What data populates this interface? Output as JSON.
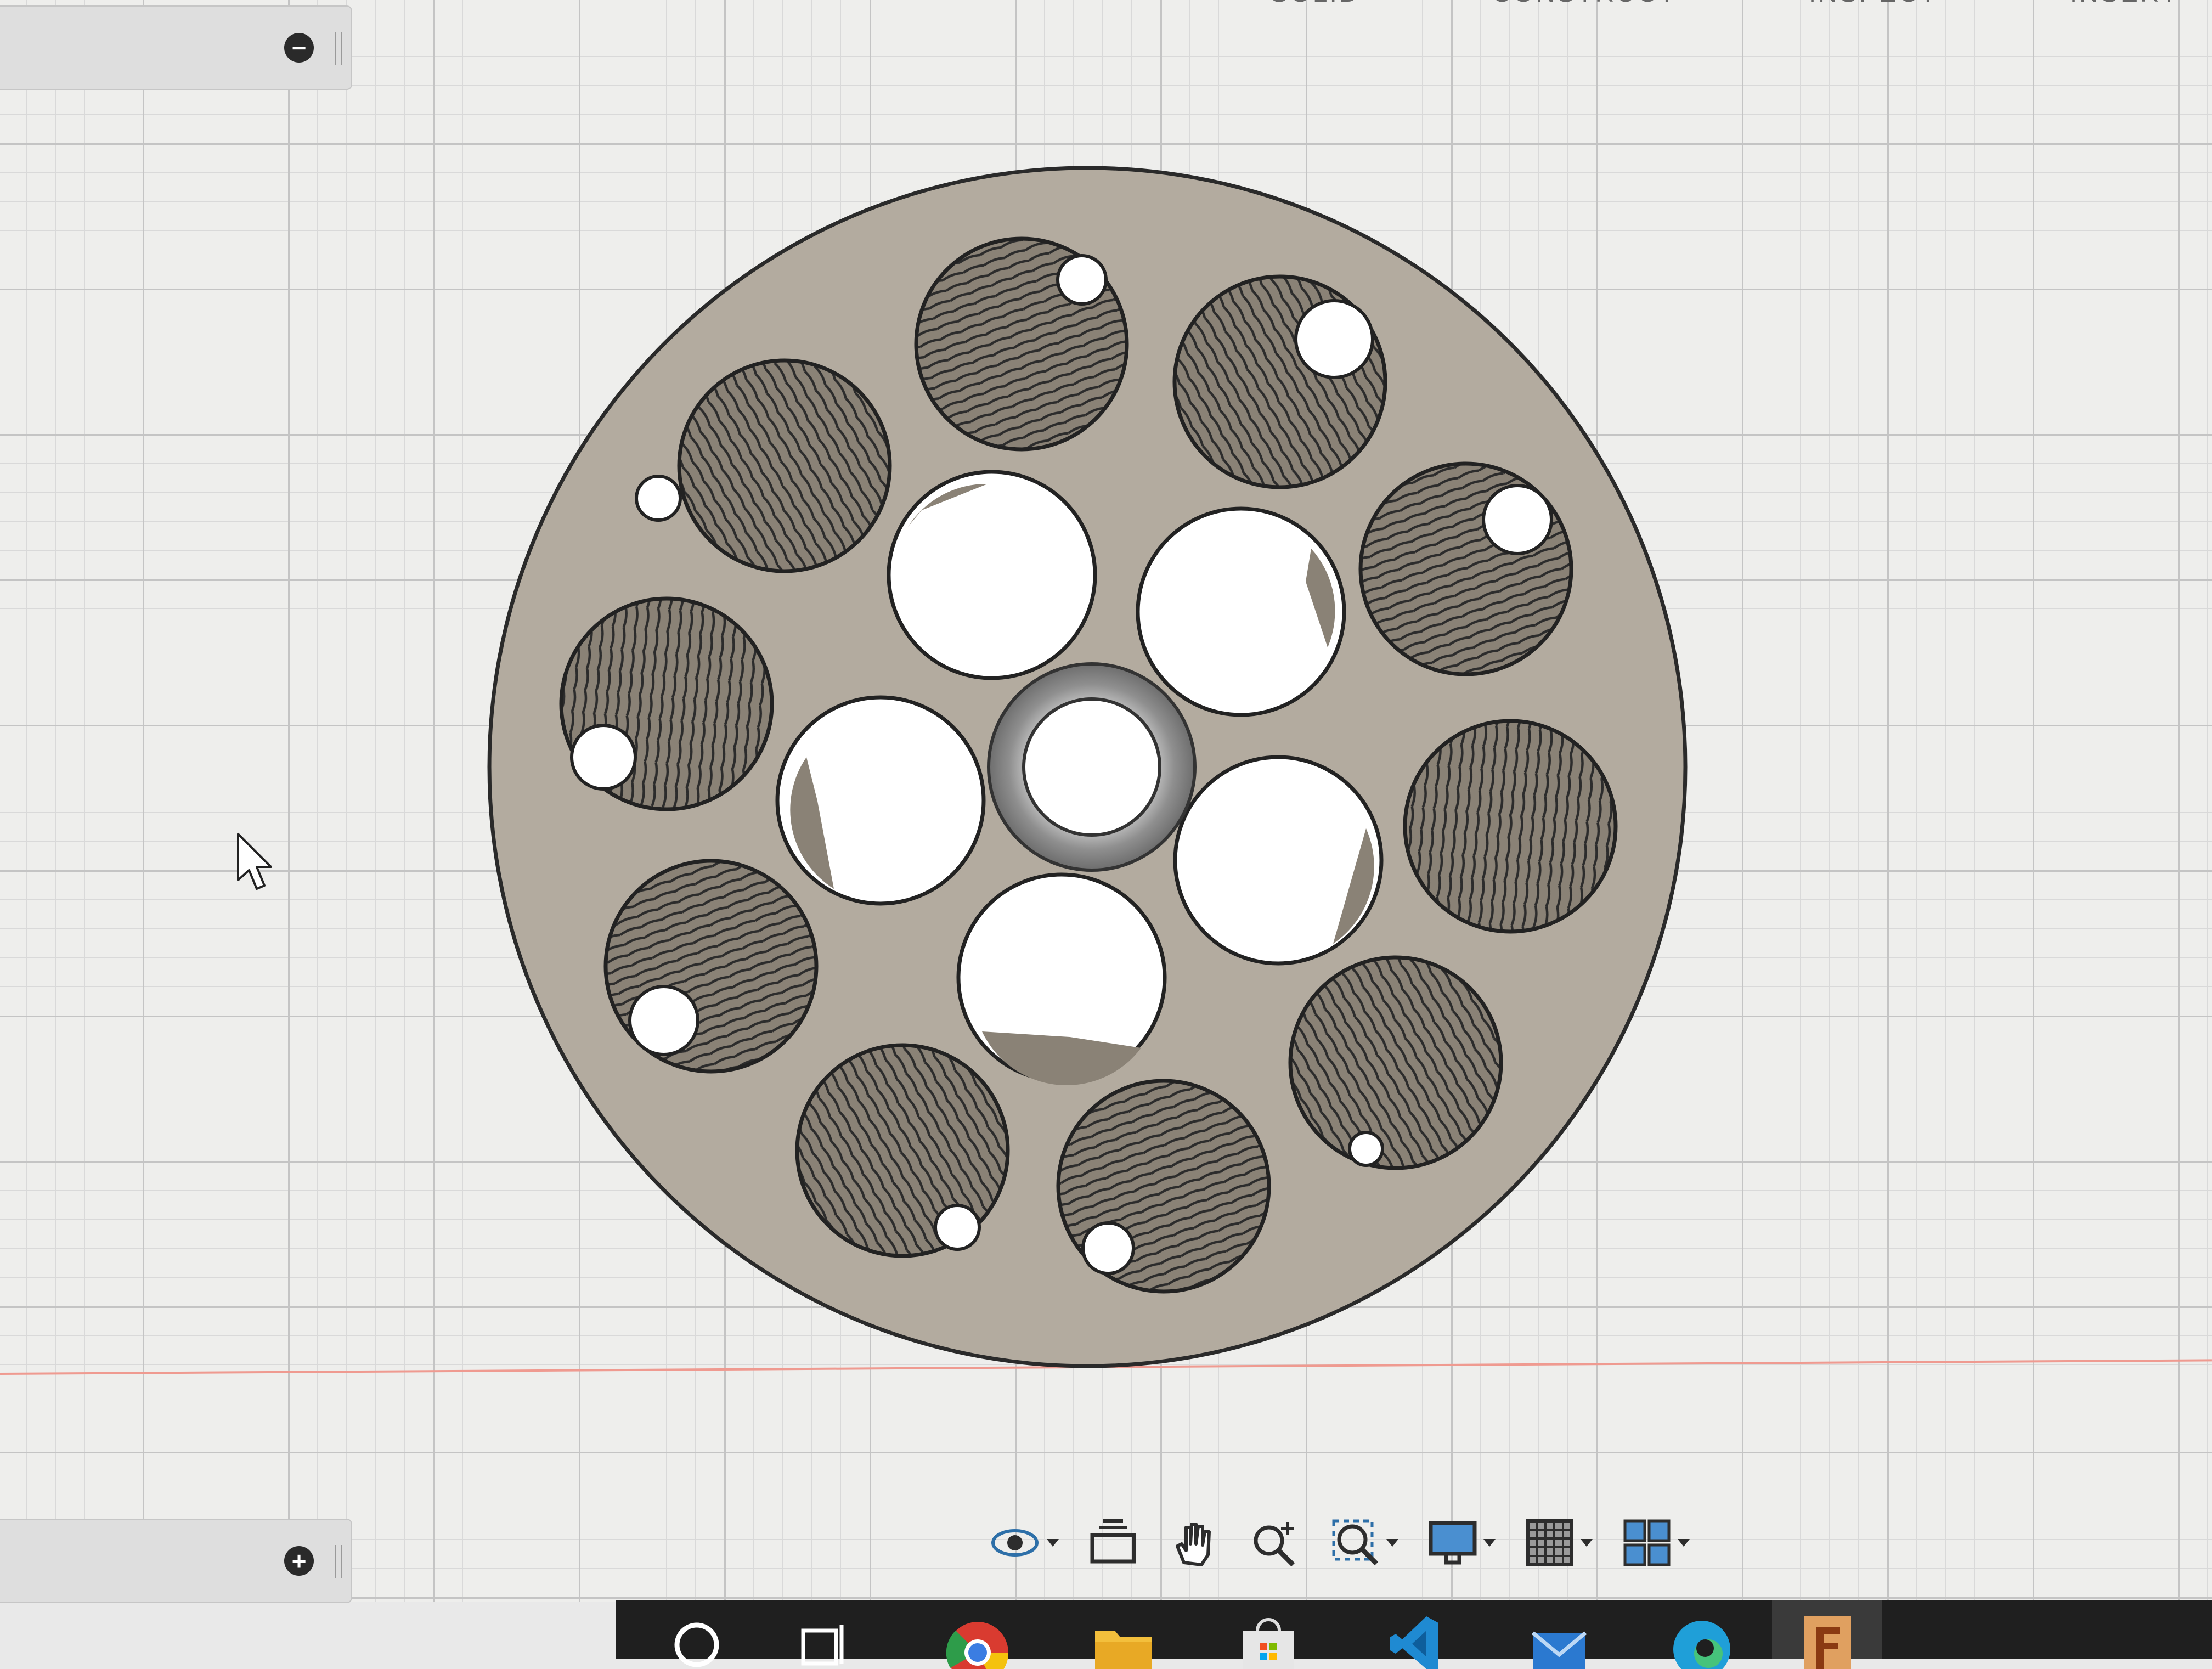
{
  "top_menu": {
    "items": [
      "SOLID",
      "CONSTRUCT",
      "INSPECT",
      "INSERT"
    ]
  },
  "panels": {
    "browser": {
      "button_symbol": "−",
      "icon": "minus-icon"
    },
    "comments": {
      "button_symbol": "+",
      "icon": "plus-icon"
    }
  },
  "navigation_toolbar": {
    "tools": [
      "orbit-icon",
      "look-at-icon",
      "pan-hand-icon",
      "zoom-icon",
      "fit-zoom-icon",
      "display-settings-icon",
      "grid-settings-icon",
      "viewports-icon"
    ]
  },
  "taskbar": {
    "icons": [
      "search-icon",
      "task-view-icon",
      "chrome-icon",
      "file-explorer-icon",
      "store-icon",
      "vscode-icon",
      "mail-icon",
      "edge-icon",
      "fusion360-icon"
    ]
  },
  "colors": {
    "part_fill": "#b3ab9f",
    "part_outline": "#2a2a2a",
    "hatch_fill": "#8a8276",
    "axis_red": "#ef9a90",
    "grid_background": "#eeeeec"
  }
}
